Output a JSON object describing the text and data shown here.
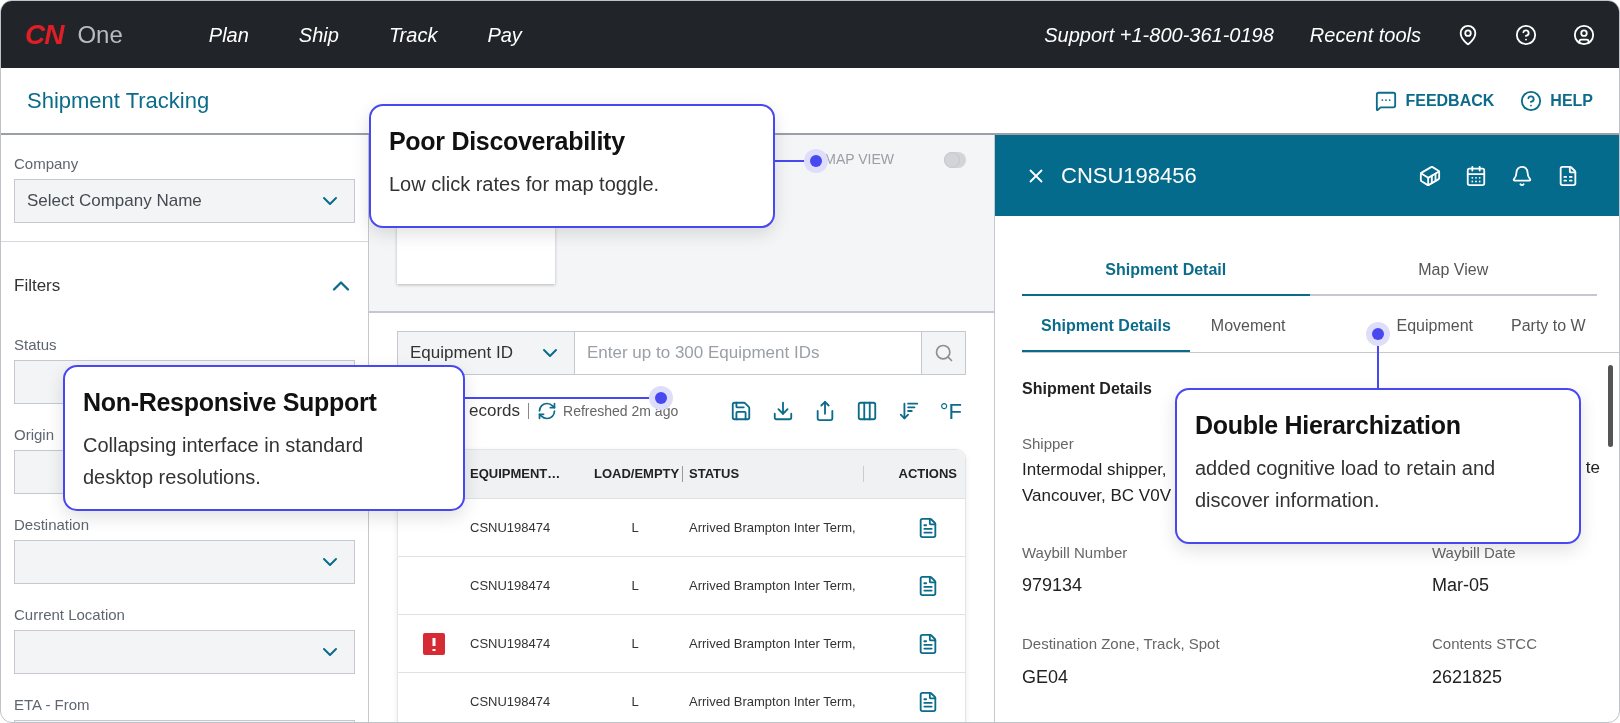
{
  "top_nav": {
    "logo": "CN",
    "product": "One",
    "menu": [
      {
        "label": "Plan"
      },
      {
        "label": "Ship"
      },
      {
        "label": "Track"
      },
      {
        "label": "Pay"
      }
    ],
    "support": "Support +1-800-361-0198",
    "recent_tools": "Recent tools"
  },
  "page_header": {
    "title": "Shipment Tracking",
    "actions": [
      {
        "label": "FEEDBACK",
        "kind": "feedback"
      },
      {
        "label": "HELP",
        "kind": "help"
      }
    ]
  },
  "sidebar": {
    "company": {
      "label": "Company",
      "value": "Select Company Name"
    },
    "filters": {
      "title": "Filters",
      "expanded": true
    },
    "fields": [
      {
        "label": "Status",
        "kind": "input"
      },
      {
        "label": "Origin",
        "kind": "input"
      },
      {
        "label": "Destination",
        "kind": "select"
      },
      {
        "label": "Current Location",
        "kind": "select"
      },
      {
        "label": "ETA - From",
        "kind": "input"
      }
    ]
  },
  "map": {
    "toggle_label": "MAP VIEW",
    "on": false
  },
  "search": {
    "dropdown": "Equipment ID",
    "placeholder": "Enter up to 300 Equipment IDs"
  },
  "toolbar": {
    "records": "ecords",
    "refreshed": "Refreshed 2m ago",
    "unit": "°F"
  },
  "table": {
    "columns": [
      "EQUIPMENT…",
      "LOAD/EMPTY",
      "STATUS",
      "ACTIONS"
    ],
    "rows": [
      {
        "alert": false,
        "equipment": "CSNU198474",
        "load": "L",
        "status": "Arrived Brampton Inter Term,"
      },
      {
        "alert": false,
        "equipment": "CSNU198474",
        "load": "L",
        "status": "Arrived Brampton Inter Term,"
      },
      {
        "alert": true,
        "equipment": "CSNU198474",
        "load": "L",
        "status": "Arrived Brampton Inter Term,"
      },
      {
        "alert": false,
        "equipment": "CSNU198474",
        "load": "L",
        "status": "Arrived Brampton Inter Term,"
      }
    ]
  },
  "detail": {
    "id": "CNSU198456",
    "tabs": [
      {
        "label": "Shipment Detail",
        "selected": true
      },
      {
        "label": "Map View",
        "selected": false
      }
    ],
    "sub_tabs": [
      {
        "label": "Shipment Details",
        "selected": true
      },
      {
        "label": "Movement",
        "selected": false
      },
      {
        "label": "Equipment",
        "selected": false
      },
      {
        "label": "Party to W",
        "selected": false
      }
    ],
    "section_title": "Shipment Details",
    "shipper": {
      "label": "Shipper",
      "lines": [
        "Intermodal shipper,",
        "Vancouver, BC V0V"
      ],
      "column_2": "te"
    },
    "fields": [
      {
        "label": "Waybill Number",
        "value": "979134"
      },
      {
        "label": "Waybill Date",
        "value": "Mar-05"
      },
      {
        "label": "Destination Zone, Track, Spot",
        "value": "GE04"
      },
      {
        "label": "Contents STCC",
        "value": "2621825"
      }
    ]
  },
  "callouts": [
    {
      "title": "Poor Discoverability",
      "body": "Low click rates for map toggle."
    },
    {
      "title": "Non-Responsive Support",
      "body": "Collapsing interface in standard desktop resolutions."
    },
    {
      "title": "Double Hierarchization",
      "body": "added cognitive load to retain and discover information."
    }
  ]
}
